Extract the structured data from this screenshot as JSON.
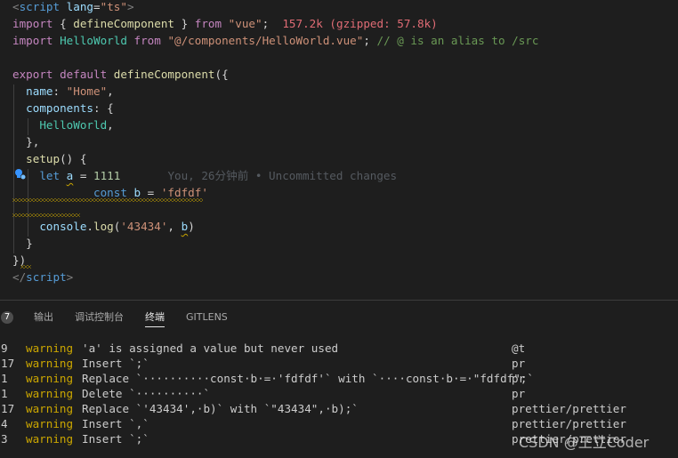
{
  "editor": {
    "lines": [
      {
        "parts": [
          [
            "tg",
            "<"
          ],
          [
            "k",
            "script"
          ],
          [
            "at",
            " lang"
          ],
          [
            "",
            "="
          ],
          [
            "st",
            "\"ts\""
          ],
          [
            "tg",
            ">"
          ]
        ]
      },
      {
        "parts": [
          [
            "kp",
            "import"
          ],
          [
            "",
            " { "
          ],
          [
            "fn",
            "defineComponent"
          ],
          [
            "",
            " } "
          ],
          [
            "kp",
            "from"
          ],
          [
            "",
            " "
          ],
          [
            "st",
            "\"vue\""
          ],
          [
            "",
            ";  "
          ],
          [
            "size",
            "157.2k (gzipped: 57.8k)"
          ]
        ]
      },
      {
        "parts": [
          [
            "kp",
            "import"
          ],
          [
            "ty",
            " HelloWorld"
          ],
          [
            "",
            " "
          ],
          [
            "kp",
            "from"
          ],
          [
            "",
            " "
          ],
          [
            "st",
            "\"@/components/HelloWorld.vue\""
          ],
          [
            "",
            "; "
          ],
          [
            "cm",
            "// @ is an alias to /src"
          ]
        ]
      },
      {
        "parts": []
      },
      {
        "parts": [
          [
            "kp",
            "export"
          ],
          [
            "",
            " "
          ],
          [
            "kp",
            "default"
          ],
          [
            "",
            " "
          ],
          [
            "fn",
            "defineComponent"
          ],
          [
            "",
            "({"
          ]
        ]
      },
      {
        "parts": [
          [
            "va",
            "  name"
          ],
          [
            "",
            ": "
          ],
          [
            "st",
            "\"Home\""
          ],
          [
            "",
            ","
          ]
        ]
      },
      {
        "parts": [
          [
            "va",
            "  components"
          ],
          [
            "",
            ": {"
          ]
        ]
      },
      {
        "parts": [
          [
            "ty",
            "    HelloWorld"
          ],
          [
            "",
            ","
          ]
        ]
      },
      {
        "parts": [
          [
            "",
            "  },"
          ]
        ]
      },
      {
        "parts": [
          [
            "fn",
            "  setup"
          ],
          [
            "",
            "() {"
          ]
        ]
      },
      {
        "parts": [
          [
            "k",
            "    let"
          ],
          [
            "",
            " "
          ],
          [
            "va",
            "a"
          ],
          [
            "",
            " = "
          ],
          [
            "nu",
            "1111"
          ],
          [
            "",
            "       "
          ],
          [
            "blame",
            "You, 26分钟前 • Uncommitted changes"
          ]
        ]
      },
      {
        "parts": [
          [
            "k",
            "            const"
          ],
          [
            "",
            " "
          ],
          [
            "va",
            "b"
          ],
          [
            "",
            " = "
          ],
          [
            "st",
            "'fdfdf'"
          ]
        ]
      },
      {
        "parts": []
      },
      {
        "parts": [
          [
            "va",
            "    console"
          ],
          [
            "",
            "."
          ],
          [
            "fn",
            "log"
          ],
          [
            "",
            "("
          ],
          [
            "st",
            "'43434'"
          ],
          [
            "",
            ", "
          ],
          [
            "va",
            "b"
          ],
          [
            "",
            ")"
          ]
        ]
      },
      {
        "parts": [
          [
            "",
            "  }"
          ]
        ]
      },
      {
        "parts": [
          [
            "",
            "})"
          ]
        ]
      },
      {
        "parts": [
          [
            "tg",
            "</"
          ],
          [
            "k",
            "script"
          ],
          [
            "tg",
            ">"
          ]
        ]
      }
    ]
  },
  "panel": {
    "badge": "7",
    "tabs": [
      {
        "label": "输出",
        "active": false
      },
      {
        "label": "调试控制台",
        "active": false
      },
      {
        "label": "终端",
        "active": true
      },
      {
        "label": "GITLENS",
        "active": false
      }
    ],
    "rows": [
      {
        "ln": "9",
        "level": "warning",
        "msg": "'a' is assigned a value but never used",
        "src": "@t"
      },
      {
        "ln": "17",
        "level": "warning",
        "msg": "Insert `;`",
        "src": "pr"
      },
      {
        "ln": "1",
        "level": "warning",
        "msg": "Replace `··········const·b·=·'fdfdf'` with `····const·b·=·\"fdfdf\";`",
        "src": "pr"
      },
      {
        "ln": "1",
        "level": "warning",
        "msg": "Delete `··········`",
        "src": "pr"
      },
      {
        "ln": "17",
        "level": "warning",
        "msg": "Replace `'43434',·b)` with `\"43434\",·b);`",
        "src": "prettier/prettier"
      },
      {
        "ln": "4",
        "level": "warning",
        "msg": "Insert `,`",
        "src": "prettier/prettier"
      },
      {
        "ln": "3",
        "level": "warning",
        "msg": "Insert `;`",
        "src": "prettier/prettier"
      }
    ]
  },
  "watermark": "CSDN @王立Coder",
  "colors": {
    "warning": "#cca700",
    "background": "#1e1e1e"
  }
}
